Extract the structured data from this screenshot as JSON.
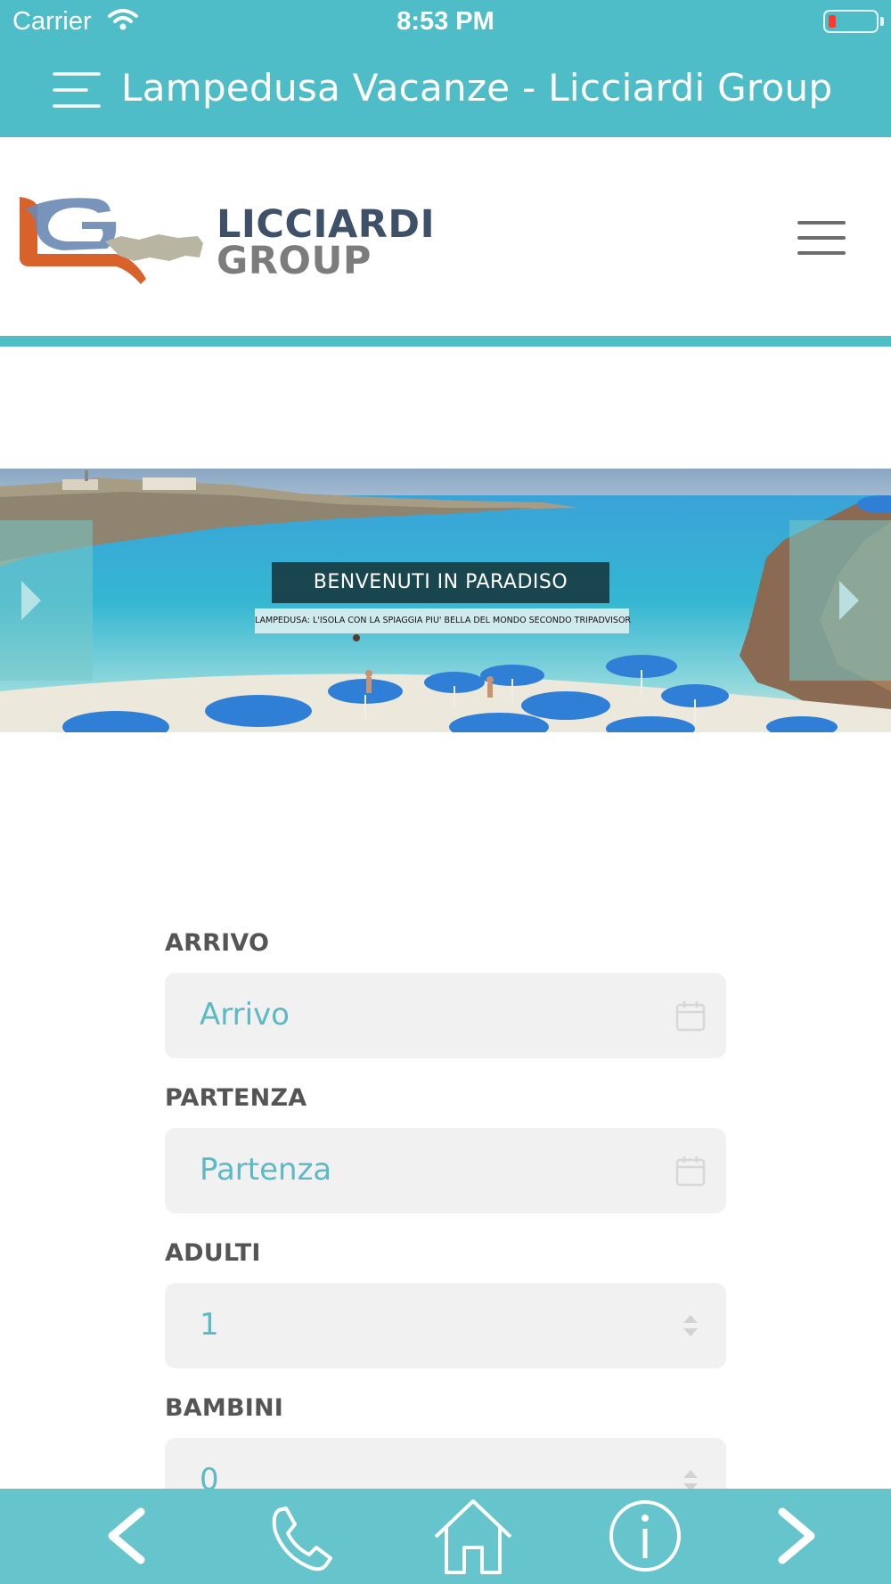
{
  "status_bar": {
    "carrier": "Carrier",
    "time": "8:53 PM",
    "battery_level": 0.15
  },
  "app_bar": {
    "title": "Lampedusa Vacanze - Licciardi Group"
  },
  "logo": {
    "line1": "LICCIARDI",
    "line2": "GROUP"
  },
  "hero": {
    "title": "BENVENUTI IN PARADISO",
    "subtitle": "LAMPEDUSA: L'ISOLA CON LA SPIAGGIA PIU' BELLA DEL MONDO SECONDO TRIPADVISOR"
  },
  "form": {
    "arrivo_label": "ARRIVO",
    "arrivo_placeholder": "Arrivo",
    "partenza_label": "PARTENZA",
    "partenza_placeholder": "Partenza",
    "adulti_label": "ADULTI",
    "adulti_value": "1",
    "bambini_label": "BAMBINI",
    "bambini_value": "0"
  },
  "bottom_bar": {
    "icons": [
      "back-icon",
      "phone-icon",
      "home-icon",
      "info-icon",
      "forward-icon"
    ]
  },
  "colors": {
    "accent": "#4fbdc7",
    "bottom_bar": "#66c4cd",
    "field_text": "#5bbac6",
    "label_text": "#555555"
  }
}
